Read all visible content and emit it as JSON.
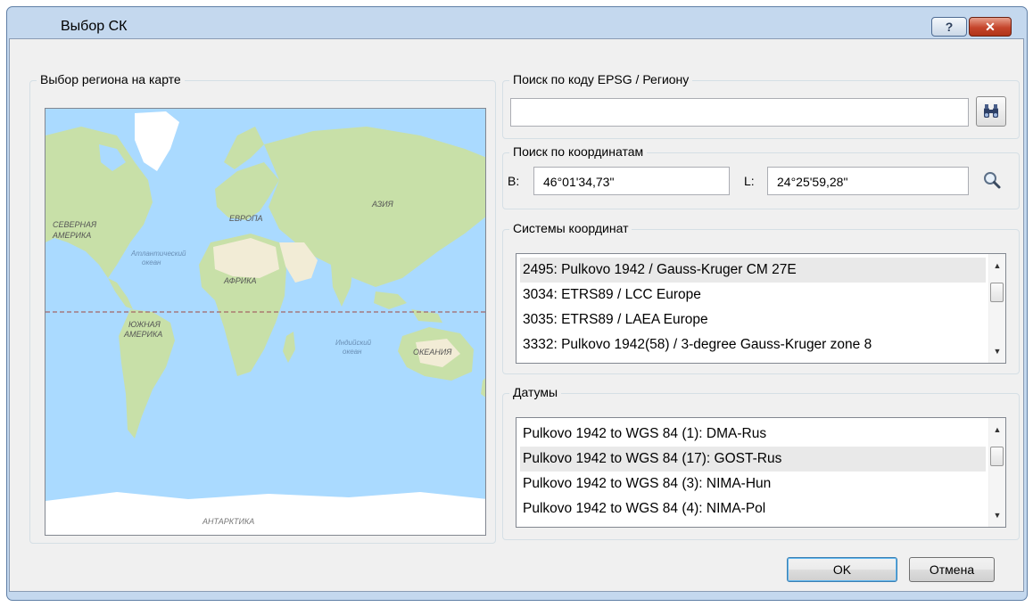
{
  "window": {
    "title": "Выбор СК"
  },
  "titlebar_buttons": {
    "help": "?",
    "close": "✕"
  },
  "map_group": {
    "title": "Выбор региона на карте",
    "labels": {
      "north_america": "СЕВЕРНАЯ",
      "north_america_2": "АМЕРИКА",
      "europe": "ЕВРОПА",
      "asia": "АЗИЯ",
      "atlantic": "Атлантический",
      "atlantic_2": "океан",
      "africa": "АФРИКА",
      "south_america": "ЮЖНАЯ",
      "south_america_2": "АМЕРИКА",
      "indian": "Индийский",
      "indian_2": "океан",
      "oceania": "ОКЕАНИЯ",
      "antarctica": "АНТАРКТИКА"
    }
  },
  "search_group": {
    "title": "Поиск по коду EPSG / Региону",
    "value": "",
    "button_icon": "binoculars-icon"
  },
  "coords_group": {
    "title": "Поиск по координатам",
    "b_label": "B:",
    "b_value": "46°01'34,73\"",
    "l_label": "L:",
    "l_value": "24°25'59,28\"",
    "button_icon": "magnifier-icon"
  },
  "crs_group": {
    "title": "Системы координат",
    "items": [
      "2495: Pulkovo 1942 / Gauss-Kruger CM 27E",
      "3034: ETRS89 / LCC Europe",
      "3035: ETRS89 / LAEA Europe",
      "3332: Pulkovo 1942(58) / 3-degree Gauss-Kruger zone 8"
    ],
    "selected_index": 0
  },
  "datum_group": {
    "title": "Датумы",
    "items": [
      "Pulkovo 1942 to WGS 84 (1): DMA-Rus",
      "Pulkovo 1942 to WGS 84 (17): GOST-Rus",
      "Pulkovo 1942 to WGS 84 (3): NIMA-Hun",
      "Pulkovo 1942 to WGS 84 (4): NIMA-Pol"
    ],
    "selected_index": 1
  },
  "buttons": {
    "ok": "OK",
    "cancel": "Отмена"
  },
  "colors": {
    "ocean": "#aadaff",
    "land": "#c8e0a8",
    "desert": "#f2ecd6",
    "ice": "#ffffff",
    "equator": "#a46666"
  }
}
